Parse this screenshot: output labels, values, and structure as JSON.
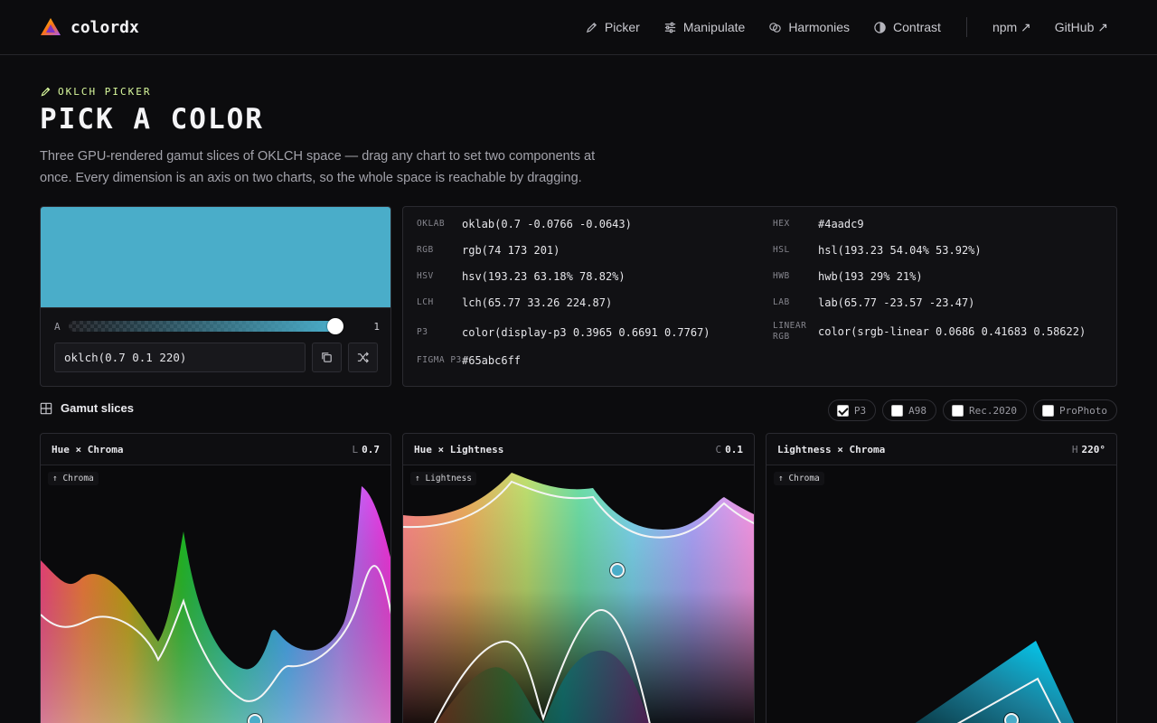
{
  "nav": {
    "brand": "colordx",
    "links": [
      {
        "label": "Picker",
        "icon": "pen-icon"
      },
      {
        "label": "Manipulate",
        "icon": "sliders-icon"
      },
      {
        "label": "Harmonies",
        "icon": "circles-icon"
      },
      {
        "label": "Contrast",
        "icon": "contrast-icon"
      }
    ],
    "external": [
      {
        "label": "npm ↗"
      },
      {
        "label": "GitHub ↗"
      }
    ]
  },
  "hero": {
    "eyebrow": "OKLCH PICKER",
    "title": "PICK A COLOR",
    "description": "Three GPU-rendered gamut slices of OKLCH space — drag any chart to set two components at once. Every dimension is an axis on two charts, so the whole space is reachable by dragging."
  },
  "preview": {
    "color": "#4aadc9",
    "alpha_label": "A",
    "alpha_value": "1",
    "alpha_fraction": 1,
    "input_value": "oklch(0.7 0.1 220)"
  },
  "formats": {
    "left": [
      {
        "key": "OKLAB",
        "value": "oklab(0.7 -0.0766 -0.0643)"
      },
      {
        "key": "RGB",
        "value": "rgb(74 173 201)"
      },
      {
        "key": "HSV",
        "value": "hsv(193.23 63.18% 78.82%)"
      },
      {
        "key": "LCH",
        "value": "lch(65.77 33.26 224.87)"
      },
      {
        "key": "P3",
        "value": "color(display-p3 0.3965 0.6691 0.7767)"
      },
      {
        "key": "FIGMA P3",
        "value": "#65abc6ff"
      }
    ],
    "right": [
      {
        "key": "HEX",
        "value": "#4aadc9"
      },
      {
        "key": "HSL",
        "value": "hsl(193.23 54.04% 53.92%)"
      },
      {
        "key": "HWB",
        "value": "hwb(193 29% 21%)"
      },
      {
        "key": "LAB",
        "value": "lab(65.77 -23.57 -23.47)"
      },
      {
        "key": "LINEAR RGB",
        "value": "color(srgb-linear 0.0686 0.41683 0.58622)"
      }
    ]
  },
  "gamut": {
    "section_title": "Gamut slices",
    "toggles": [
      {
        "label": "P3",
        "checked": true
      },
      {
        "label": "A98",
        "checked": false
      },
      {
        "label": "Rec.2020",
        "checked": false
      },
      {
        "label": "ProPhoto",
        "checked": false
      }
    ]
  },
  "panels": [
    {
      "title": "Hue × Chroma",
      "fixed_key": "L",
      "fixed_value": "0.7",
      "axis": "↑ Chroma"
    },
    {
      "title": "Hue × Lightness",
      "fixed_key": "C",
      "fixed_value": "0.1",
      "axis": "↑ Lightness"
    },
    {
      "title": "Lightness × Chroma",
      "fixed_key": "H",
      "fixed_value": "220°",
      "axis": "↑ Chroma"
    }
  ]
}
